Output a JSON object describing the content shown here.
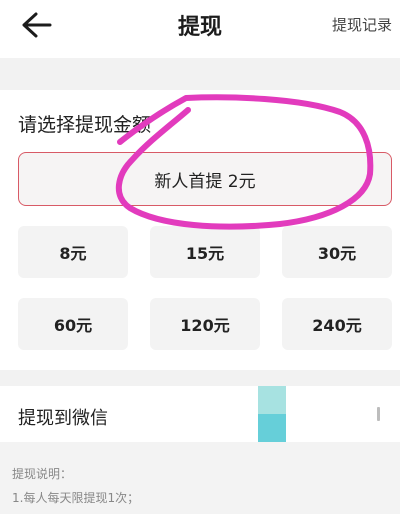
{
  "header": {
    "title": "提现",
    "records_label": "提现记录"
  },
  "amount_section": {
    "title": "请选择提现金额",
    "featured_label": "新人首提 2元",
    "options": [
      "8元",
      "15元",
      "30元",
      "60元",
      "120元",
      "240元"
    ]
  },
  "wechat": {
    "label": "提现到微信"
  },
  "notes": {
    "heading": "提现说明：",
    "line1": "1.每人每天限提现1次；"
  },
  "icons": {
    "back": "back-arrow-icon"
  },
  "colors": {
    "highlight_scribble": "#e23bbd",
    "featured_border": "#d85a66",
    "wechat_mark": "#66cfd9"
  }
}
